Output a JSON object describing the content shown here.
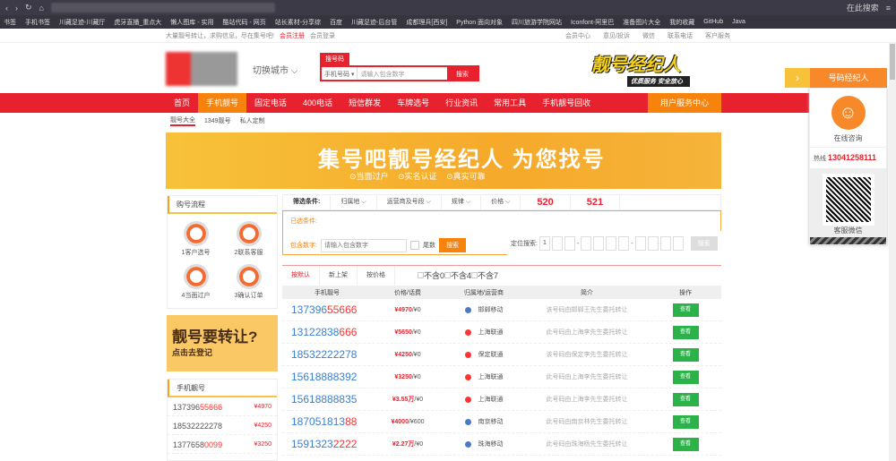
{
  "browser": {
    "search_hint": "在此搜索",
    "bookmarks": [
      "书签",
      "手机书签",
      "川藏足迹-川藏厅",
      "虎牙直播_重点大",
      "懒人图库 - 实用",
      "酷站代码 - 网页",
      "站长素材-分享综",
      "百度",
      "川藏足迹-后台管",
      "成都理兵[西安]",
      "Python 面向对象",
      "四川旅游学院网站",
      "Iconfont-阿里巴",
      "准备图片大全",
      "我的收藏",
      "GitHub",
      "Java"
    ]
  },
  "topbar": {
    "intro": "大量靓号转让，求购信息，尽在集号吧!",
    "register": "会员注册",
    "login": "会员登录",
    "links": [
      "会员中心",
      "意见/投诉",
      "微信",
      "联系电话",
      "客户服务"
    ]
  },
  "header": {
    "city": "切换城市",
    "search_tab": "搜号码",
    "search_select": "手机号码",
    "search_placeholder": "请输入包含数字",
    "search_btn": "搜索",
    "agent_title": "靓号经纪人",
    "agent_sub": "优质服务 安全放心"
  },
  "nav": {
    "items": [
      "首页",
      "手机靓号",
      "固定电话",
      "400电话",
      "短信群发",
      "车牌选号",
      "行业资讯",
      "常用工具",
      "手机靓号回收"
    ],
    "service": "用户服务中心"
  },
  "subnav": [
    "靓号大全",
    "1349靓号",
    "私人定制"
  ],
  "banner": {
    "title": "集号吧靓号经纪人 为您找号",
    "points": "⊙当面过户 ⊙实名认证 ⊙真实可靠"
  },
  "process": {
    "title": "购号流程",
    "steps": [
      "1客户选号",
      "2联系客服",
      "4当面过户",
      "3确认订单"
    ]
  },
  "transfer": {
    "title": "靓号要转让?",
    "sub": "点击去登记"
  },
  "phone_list": {
    "title": "手机靓号",
    "items": [
      {
        "a": "137396",
        "b": "55666",
        "price": "¥4970"
      },
      {
        "a": "18532222278",
        "b": "",
        "price": "¥4250"
      },
      {
        "a": "1377658",
        "b": "0099",
        "price": "¥3250"
      }
    ]
  },
  "filter": {
    "label": "筛选条件:",
    "items": [
      "归属地 ⌵",
      "运营商及号段 ⌵",
      "规律 ⌵",
      "价格 ⌵"
    ],
    "special": [
      "520",
      "521"
    ],
    "selected": "已选条件:",
    "contains": "包含数字:",
    "contains_placeholder": "请输入包含数字",
    "tail": "尾数",
    "search": "搜索",
    "pos_label": "定位搜索:",
    "pos_first": "1",
    "pos_btn": "搜索"
  },
  "list": {
    "tabs": [
      "按默认",
      "新上架",
      "按价格"
    ],
    "excl": [
      "不含0",
      "不含4",
      "不含7"
    ],
    "headers": [
      "手机靓号",
      "价格/话费",
      "归属地/运营商",
      "简介",
      "操作"
    ],
    "rows": [
      {
        "a": "137396",
        "b": "55666",
        "price": "¥4970",
        "fee": "/¥0",
        "carrier": "邯郸移动",
        "desc": "该号码由邯郸王先生委托转让",
        "btn": "查看",
        "c": "#4a79c8"
      },
      {
        "a": "13122838",
        "b": "666",
        "price": "¥5650",
        "fee": "/¥0",
        "carrier": "上海联通",
        "desc": "此号码由上海李先生委托转让",
        "btn": "查看",
        "c": "#f33"
      },
      {
        "a": "18532222278",
        "b": "",
        "price": "¥4250",
        "fee": "/¥0",
        "carrier": "保定联通",
        "desc": "该号码由保定李先生委托转让",
        "btn": "查看",
        "c": "#f33"
      },
      {
        "a": "15618888392",
        "b": "",
        "price": "¥3250",
        "fee": "/¥0",
        "carrier": "上海联通",
        "desc": "此号码由上海李先生委托转让",
        "btn": "查看",
        "c": "#f33"
      },
      {
        "a": "15618888835",
        "b": "",
        "price": "¥3.55万",
        "fee": "/¥0",
        "carrier": "上海联通",
        "desc": "此号码由上海李先生委托转让",
        "btn": "查看",
        "c": "#f33"
      },
      {
        "a": "187051813",
        "b": "88",
        "price": "¥4000",
        "fee": "/¥600",
        "carrier": "南京移动",
        "desc": "此号码由南京林先生委托转让",
        "btn": "查看",
        "c": "#4a79c8"
      },
      {
        "a": "1591323",
        "b": "2222",
        "price": "¥2.27万",
        "fee": "/¥0",
        "carrier": "珠海移动",
        "desc": "此号码由珠海杨先生委托转让",
        "btn": "查看",
        "c": "#4a79c8"
      }
    ]
  },
  "side": {
    "title": "号码经纪人",
    "consult": "在线咨询",
    "hotline_label": "热线",
    "hotline": "13041258111",
    "wechat": "客服微信"
  }
}
